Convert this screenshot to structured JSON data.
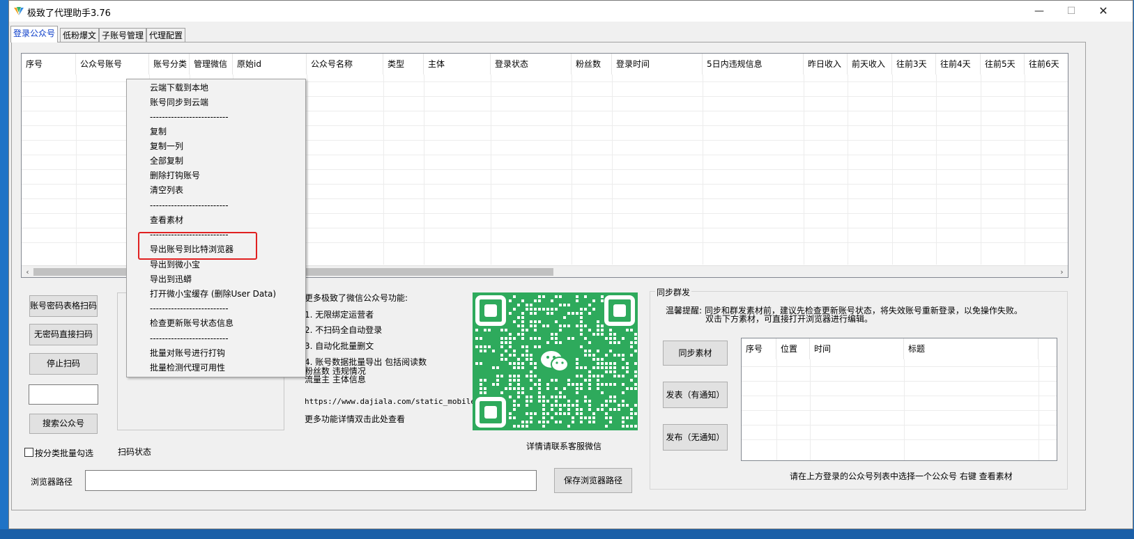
{
  "window": {
    "title": "极致了代理助手3.76",
    "minimize_glyph": "—",
    "maximize_glyph": "☐",
    "close_glyph": "✕"
  },
  "tabs": [
    {
      "label": "登录公众号",
      "active": true
    },
    {
      "label": "低粉爆文",
      "active": false
    },
    {
      "label": "子账号管理",
      "active": false
    },
    {
      "label": "代理配置",
      "active": false
    }
  ],
  "grid": {
    "columns": [
      "序号",
      "公众号账号",
      "账号分类",
      "管理微信",
      "原始id",
      "公众号名称",
      "类型",
      "主体",
      "登录状态",
      "粉丝数",
      "登录时间",
      "5日内违规信息",
      "昨日收入",
      "前天收入",
      "往前3天",
      "往前4天",
      "往前5天",
      "往前6天"
    ],
    "scroll_left_glyph": "‹",
    "scroll_right_glyph": "›"
  },
  "context_menu": {
    "items": [
      "云端下载到本地",
      "账号同步到云端",
      "--------------------------",
      "复制",
      "复制一列",
      "全部复制",
      "删除打钩账号",
      "清空列表",
      "--------------------------",
      "查看素材",
      "--------------------------",
      "导出账号到比特浏览器",
      "导出到微小宝",
      "导出到迅蟒",
      "打开微小宝缓存 (删除User Data)",
      "--------------------------",
      "检查更新账号状态信息",
      "--------------------------",
      "批量对账号进行打钩",
      "批量检测代理可用性"
    ],
    "highlighted_item": "导出账号到比特浏览器"
  },
  "left_panel": {
    "btn_password_scan": "账号密码表格扫码",
    "btn_no_password_scan": "无密码直接扫码",
    "btn_stop_scan": "停止扫码",
    "search_value": "",
    "btn_search": "搜索公众号",
    "checkbox_label": "按分类批量勾选",
    "scan_status_label": "扫码状态",
    "browser_path_label": "浏览器路径",
    "browser_path_value": "",
    "btn_save_path": "保存浏览器路径"
  },
  "promo": {
    "heading_visible": "更多极致了微信公众号功能:",
    "lines": [
      "1. 无限绑定运营者",
      "2. 不扫码全自动登录",
      "3. 自动化批量删文",
      "4. 账号数据批量导出 包括阅读数",
      "粉丝数 违规情况",
      "流量主 主体信息"
    ],
    "url": "https://www.dajiala.com/static_mobile,",
    "more": "更多功能详情双击此处查看",
    "qr_caption": "详情请联系客服微信"
  },
  "sync": {
    "group_title": "同步群发",
    "tip_line1": "温馨提醒: 同步和群发素材前，建议先检查更新账号状态，将失效账号重新登录，以免操作失败。",
    "tip_line2": "双击下方素材，可直接打开浏览器进行编辑。",
    "btn_sync": "同步素材",
    "btn_publish_notify": "发表（有通知）",
    "btn_publish_silent": "发布（无通知）",
    "list_columns": [
      "序号",
      "位置",
      "时间",
      "标题"
    ],
    "hint": "请在上方登录的公众号列表中选择一个公众号 右键 查看素材"
  },
  "colors": {
    "highlight_border": "#e02020",
    "qr_green": "#2eaa5c",
    "active_tab_text": "#0a3cc9"
  }
}
